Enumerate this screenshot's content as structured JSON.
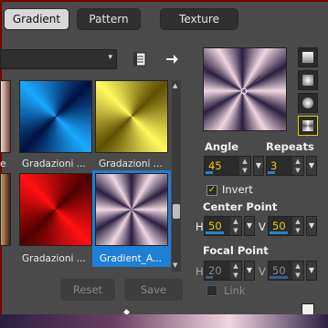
{
  "tabs": [
    {
      "label": "Gradient",
      "active": true
    },
    {
      "label": "Pattern",
      "active": false
    },
    {
      "label": "Texture",
      "active": false
    }
  ],
  "icons": {
    "notes": "notes-icon",
    "arrow": "arrow-right-icon"
  },
  "tiles": [
    {
      "label": "e"
    },
    {
      "label": "Gradazioni ..."
    },
    {
      "label": "Gradazioni ..."
    },
    {
      "label": "Gradazioni ..."
    },
    {
      "label": "Gradient_A..."
    }
  ],
  "buttons": {
    "reset": "Reset",
    "save": "Save"
  },
  "angle": {
    "label": "Angle",
    "value": "45"
  },
  "repeats": {
    "label": "Repeats",
    "value": "3"
  },
  "invert": {
    "label": "Invert",
    "checked": true
  },
  "center_point": {
    "label": "Center Point",
    "h_label": "H",
    "h": "50",
    "v_label": "V",
    "v": "50"
  },
  "focal_point": {
    "label": "Focal Point",
    "h_label": "H",
    "h": "20",
    "v_label": "V",
    "v": "50"
  },
  "link": {
    "label": "Link",
    "checked": false
  },
  "colors": {
    "accent": "#1e7fd6",
    "value_text": "#f0d000",
    "border_red": "#7a0000"
  }
}
